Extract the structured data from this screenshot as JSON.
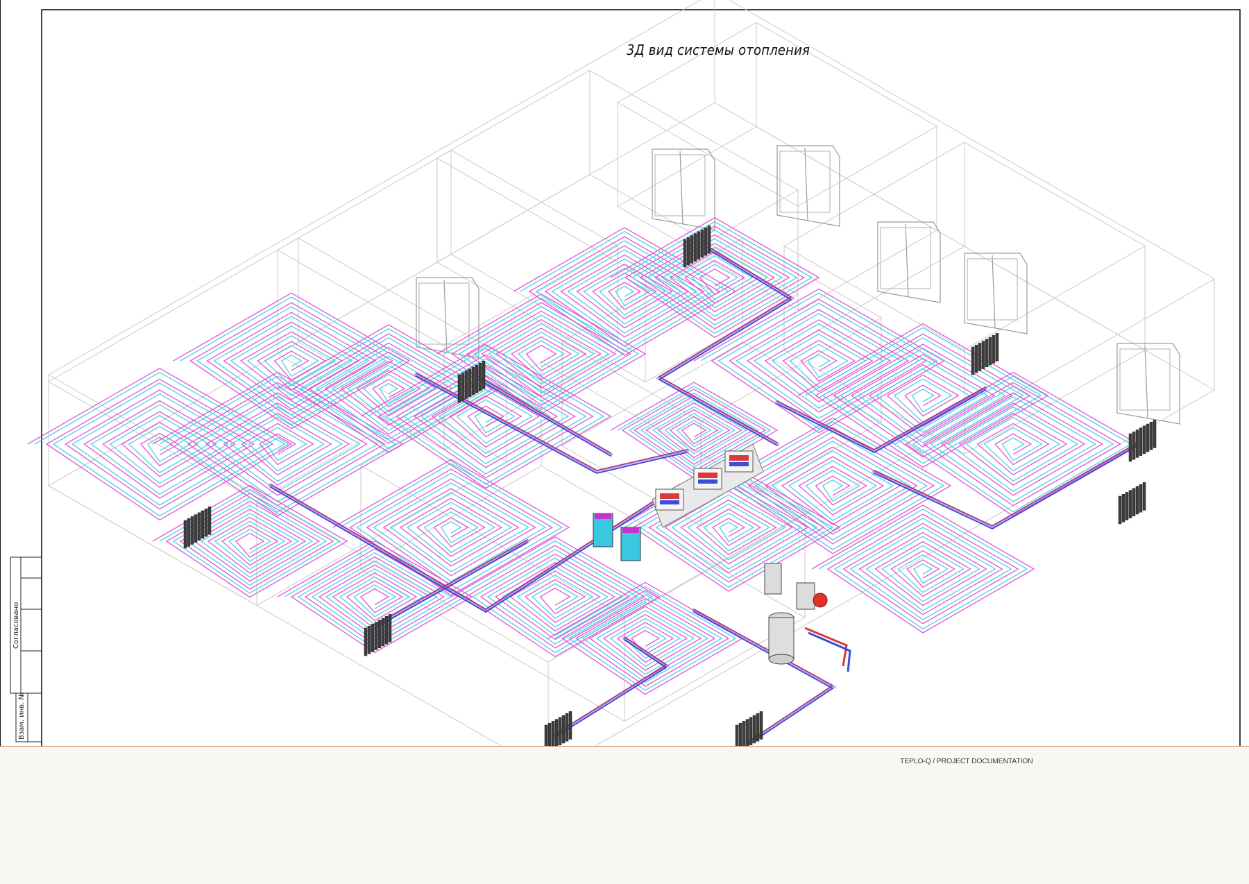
{
  "drawing": {
    "title": "3Д вид системы отопления"
  },
  "title_block": {
    "agreed_label": "Согласовано",
    "inv_label": "Взам. инв. №"
  },
  "footer": {
    "text": "TEPLO-Q / PROJECT DOCUMENTATION"
  },
  "colors": {
    "supply_loop": "#e04bd8",
    "return_loop": "#45cfd9",
    "main_pipe": "#7a6fe8",
    "wall_lines": "#c8c8c8",
    "footer_rule": "#c9925b",
    "footer_bg": "#f8f7f3"
  }
}
